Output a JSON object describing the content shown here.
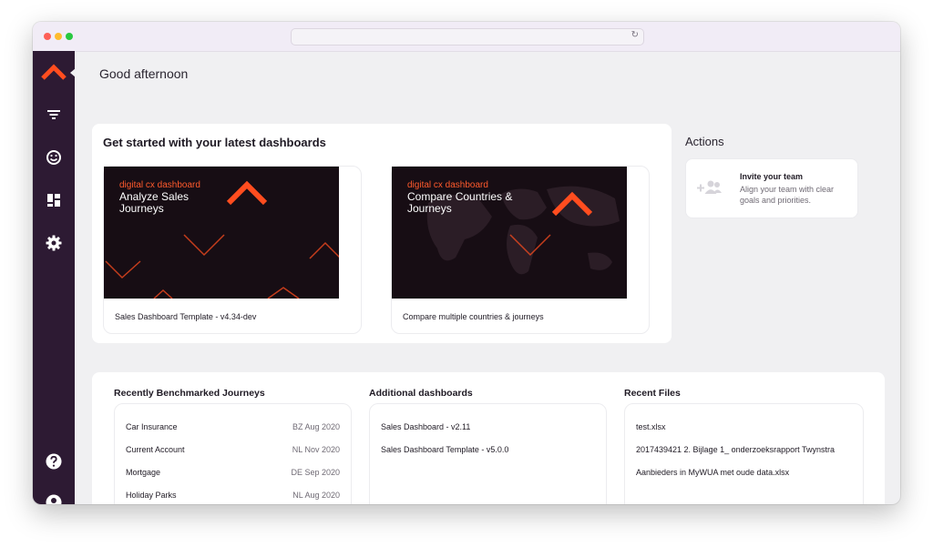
{
  "greeting": "Good afternoon",
  "sidebar": {
    "items": [
      {
        "name": "filter-icon"
      },
      {
        "name": "smiley-icon"
      },
      {
        "name": "dashboard-icon"
      },
      {
        "name": "gear-icon"
      },
      {
        "name": "help-icon"
      },
      {
        "name": "user-icon"
      }
    ]
  },
  "latest": {
    "title": "Get started with your latest dashboards",
    "cards": [
      {
        "kicker": "digital cx dashboard",
        "heading": "Analyze Sales Journeys",
        "caption": "Sales Dashboard Template - v4.34-dev"
      },
      {
        "kicker": "digital cx dashboard",
        "heading": "Compare Countries & Journeys",
        "caption": "Compare multiple countries & journeys"
      }
    ]
  },
  "actions": {
    "title": "Actions",
    "items": [
      {
        "title": "Invite your team",
        "description": "Align your team with clear goals and priorities."
      }
    ]
  },
  "benchmarked": {
    "title": "Recently Benchmarked Journeys",
    "rows": [
      {
        "name": "Car Insurance",
        "meta": "BZ Aug 2020"
      },
      {
        "name": "Current Account",
        "meta": "NL Nov 2020"
      },
      {
        "name": "Mortgage",
        "meta": "DE Sep 2020"
      },
      {
        "name": "Holiday Parks",
        "meta": "NL Aug 2020"
      }
    ]
  },
  "additional": {
    "title": "Additional dashboards",
    "rows": [
      "Sales Dashboard - v2.11",
      "Sales Dashboard Template - v5.0.0"
    ]
  },
  "files": {
    "title": "Recent Files",
    "rows": [
      "test.xlsx",
      "2017439421 2. Bijlage 1_ onderzoeksrapport Twynstra",
      "Aanbieders in MyWUA met oude data.xlsx"
    ]
  },
  "colors": {
    "brand": "#ff4d1f",
    "sidebar": "#2d1a33",
    "thumb_bg": "#170d14"
  }
}
